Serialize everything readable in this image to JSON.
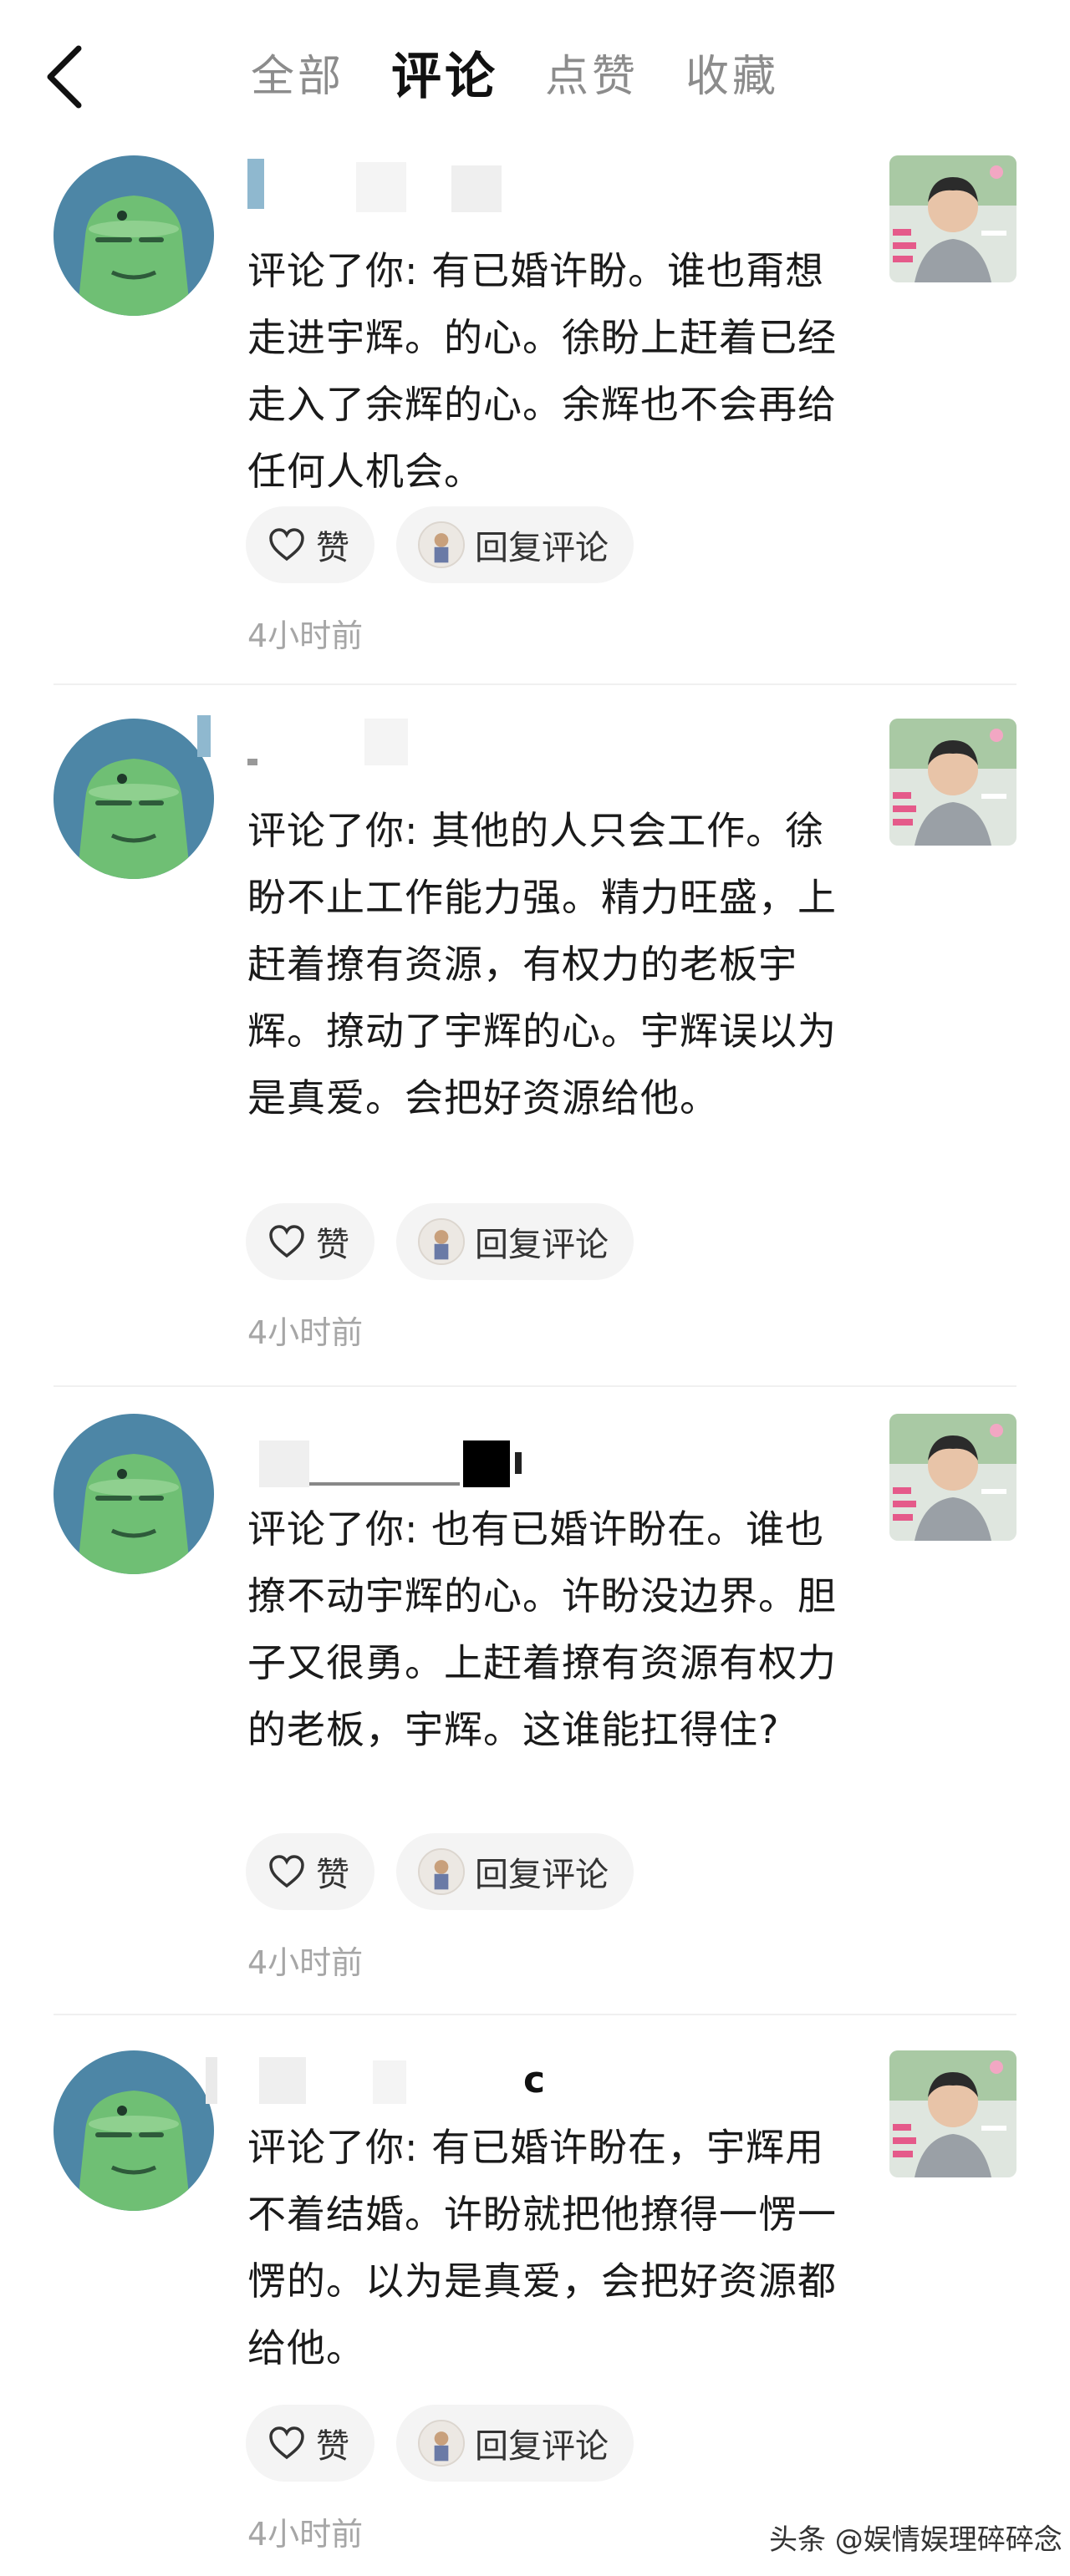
{
  "header": {
    "tabs": [
      "全部",
      "评论",
      "点赞",
      "收藏"
    ],
    "active_tab": "评论"
  },
  "comments": [
    {
      "name_fragment": "",
      "text": "评论了你: 有已婚许盼。谁也甭想走进宇辉。的心。徐盼上赶着已经走入了余辉的心。余辉也不会再给任何人机会。",
      "like_label": "赞",
      "reply_label": "回复评论",
      "time": "4小时前"
    },
    {
      "name_fragment": "",
      "text": "评论了你: 其他的人只会工作。徐盼不止工作能力强。精力旺盛，上赶着撩有资源，有权力的老板宇辉。撩动了宇辉的心。宇辉误以为是真爱。会把好资源给他。",
      "like_label": "赞",
      "reply_label": "回复评论",
      "time": "4小时前"
    },
    {
      "name_fragment": "",
      "text": "评论了你: 也有已婚许盼在。谁也撩不动宇辉的心。许盼没边界。胆子又很勇。上赶着撩有资源有权力的老板，宇辉。这谁能扛得住?",
      "like_label": "赞",
      "reply_label": "回复评论",
      "time": "4小时前"
    },
    {
      "name_fragment": "c",
      "text": "评论了你: 有已婚许盼在，宇辉用不着结婚。许盼就把他撩得一愣一愣的。以为是真爱，会把好资源都给他。",
      "like_label": "赞",
      "reply_label": "回复评论",
      "time": "4小时前"
    }
  ],
  "watermark": "头条 @娱情娱理碎碎念",
  "colors": {
    "avatar_bg": "#4d86a6",
    "creature": "#6fbf74",
    "pill_bg": "#f4f4f4",
    "time_text": "#a6a6a6",
    "inactive_tab": "#8c8c8c"
  }
}
